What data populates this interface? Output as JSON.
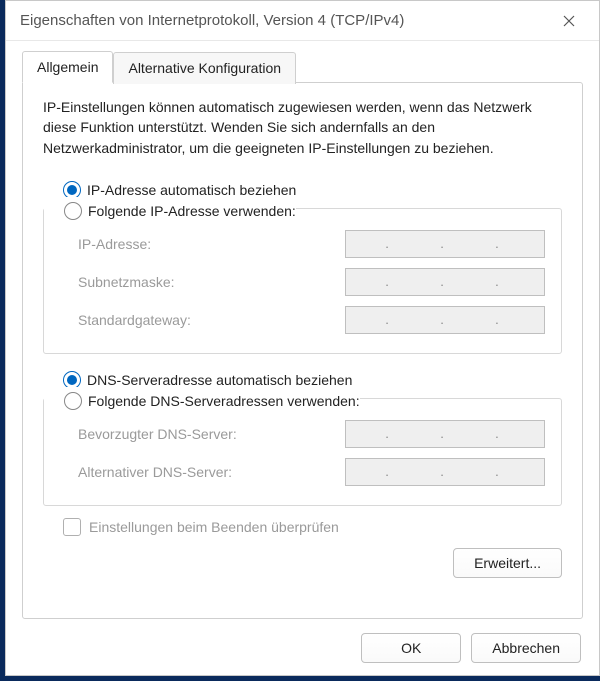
{
  "window": {
    "title": "Eigenschaften von Internetprotokoll, Version 4 (TCP/IPv4)"
  },
  "tabs": {
    "general": "Allgemein",
    "alternative": "Alternative Konfiguration"
  },
  "description": "IP-Einstellungen können automatisch zugewiesen werden, wenn das Netzwerk diese Funktion unterstützt. Wenden Sie sich andernfalls an den Netzwerkadministrator, um die geeigneten IP-Einstellungen zu beziehen.",
  "ip_group": {
    "auto_label": "IP-Adresse automatisch beziehen",
    "manual_label": "Folgende IP-Adresse verwenden:",
    "ip_label": "IP-Adresse:",
    "subnet_label": "Subnetzmaske:",
    "gateway_label": "Standardgateway:",
    "selected": "auto"
  },
  "dns_group": {
    "auto_label": "DNS-Serveradresse automatisch beziehen",
    "manual_label": "Folgende DNS-Serveradressen verwenden:",
    "preferred_label": "Bevorzugter DNS-Server:",
    "alternate_label": "Alternativer DNS-Server:",
    "selected": "auto"
  },
  "validate_checkbox": {
    "label": "Einstellungen beim Beenden überprüfen",
    "checked": false
  },
  "buttons": {
    "advanced": "Erweitert...",
    "ok": "OK",
    "cancel": "Abbrechen"
  },
  "ip_placeholder": ".     .     ."
}
